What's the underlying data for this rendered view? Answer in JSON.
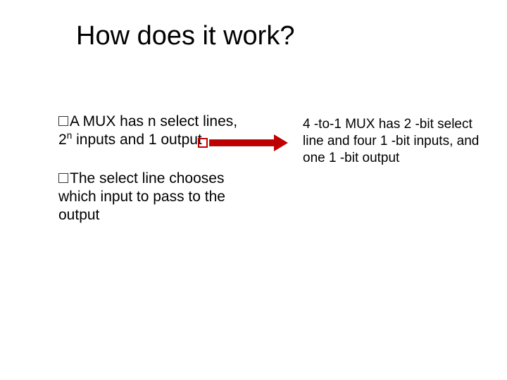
{
  "title": "How does it work?",
  "bullets": [
    {
      "pre": "A MUX has n select lines, 2",
      "sup": "n",
      "post": " inputs and 1 output"
    },
    {
      "text": "The select line chooses which input to pass to the output"
    }
  ],
  "right_text": "4 -to-1 MUX has 2 -bit select line and four 1 -bit inputs, and one 1 -bit output"
}
